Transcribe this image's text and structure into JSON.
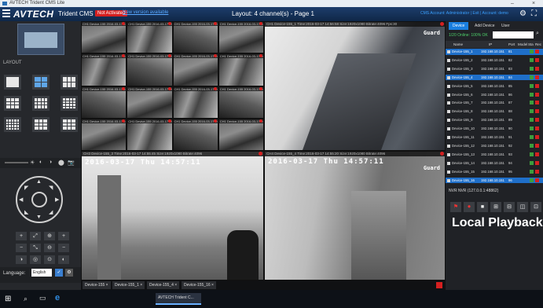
{
  "window": {
    "title": "AVTECH Trident CMS Lite",
    "minimize": "–",
    "close": "×"
  },
  "header": {
    "logo": "AVTECH",
    "app_name": "Trident CMS Lite",
    "not_activated": "Not Activated",
    "new_version": "New version available",
    "layout_title": "Layout: 4 channel(s) - Page 1",
    "account": "CMS Account: Administrator | Exit | Account: demo",
    "gear_icon": "⚙",
    "fullscreen_icon": "⛶"
  },
  "left": {
    "layout_label": "LAYOUT",
    "layouts": [
      {
        "rows": 1,
        "cols": 1,
        "active": false
      },
      {
        "rows": 2,
        "cols": 2,
        "active": true
      },
      {
        "rows": 2,
        "cols": 3,
        "active": false
      },
      {
        "rows": 3,
        "cols": 3,
        "active": false
      },
      {
        "rows": 3,
        "cols": 4,
        "active": false
      },
      {
        "rows": 4,
        "cols": 4,
        "active": false
      },
      {
        "rows": 4,
        "cols": 5,
        "active": false
      },
      {
        "rows": 3,
        "cols": 3,
        "active": false
      },
      {
        "rows": 3,
        "cols": 3,
        "active": false
      }
    ],
    "ptz_icons": [
      "☀",
      "◐",
      "◑",
      "⬤",
      "📷"
    ],
    "arrows": [
      "▲",
      "▼",
      "◀",
      "▶",
      "◤",
      "◥",
      "◣",
      "◢"
    ],
    "ptz_buttons": [
      "+",
      "⤢",
      "⊕",
      "+",
      "−",
      "⤡",
      "⊖",
      "−",
      "◑",
      "◎",
      "⊙",
      "◐"
    ],
    "language_label": "Language:",
    "language_value": "English"
  },
  "videos": {
    "small_header": "CH1 Device-155 2016-03-17 14:56:17",
    "big": [
      {
        "header": "CH1 Device-155_1 Time:2016-03-17 14:56:58 Size:1920x1080 Bitrate:4096 Fps:30",
        "osd": "",
        "guard": "Guard"
      },
      {
        "header": "CH2 Device-155_2 Time:2016-03-17 14:57:32 Size:1920x1080 Bitrate:4096 Fps:30",
        "osd": "",
        "guard": "Guard"
      },
      {
        "header": "CH3 Device-155_3 Time:2016-03-17 14:55:45 Size:1920x1080 Bitrate:4096",
        "osd": "2016-03-17 Thu 14:57:11",
        "guard": ""
      },
      {
        "header": "CH4 Device-155_4 Time:2016-03-17 14:55:20 Size:1920x1080 Bitrate:4096",
        "osd": "2016-03-17 Thu 14:57:11",
        "guard": "Guard"
      }
    ],
    "tabs": [
      "Device-155 ×",
      "Device-155_1 ×",
      "Device-155_4 ×",
      "Device-155_16 ×"
    ]
  },
  "right": {
    "tabs": [
      "Device",
      "Add Device",
      "User"
    ],
    "device_status": "1/20 Online: 100% OK",
    "columns": [
      "Name",
      "IP",
      "Port",
      "Model",
      "Sta",
      "Rec"
    ],
    "devices": [
      {
        "name": "Device-155_1",
        "ip": "192.168.10.151",
        "port": "81",
        "selected": true
      },
      {
        "name": "Device-155_2",
        "ip": "192.168.10.151",
        "port": "82",
        "selected": false
      },
      {
        "name": "Device-155_3",
        "ip": "192.168.10.151",
        "port": "83",
        "selected": false
      },
      {
        "name": "Device-155_4",
        "ip": "192.168.10.151",
        "port": "84",
        "selected": true
      },
      {
        "name": "Device-155_5",
        "ip": "192.168.10.151",
        "port": "85",
        "selected": false
      },
      {
        "name": "Device-155_6",
        "ip": "192.168.10.151",
        "port": "86",
        "selected": false
      },
      {
        "name": "Device-155_7",
        "ip": "192.168.10.151",
        "port": "87",
        "selected": false
      },
      {
        "name": "Device-155_8",
        "ip": "192.168.10.151",
        "port": "88",
        "selected": false
      },
      {
        "name": "Device-155_9",
        "ip": "192.168.10.151",
        "port": "89",
        "selected": false
      },
      {
        "name": "Device-155_10",
        "ip": "192.168.10.151",
        "port": "90",
        "selected": false
      },
      {
        "name": "Device-155_11",
        "ip": "192.168.10.151",
        "port": "91",
        "selected": false
      },
      {
        "name": "Device-155_12",
        "ip": "192.168.10.151",
        "port": "92",
        "selected": false
      },
      {
        "name": "Device-155_13",
        "ip": "192.168.10.151",
        "port": "93",
        "selected": false
      },
      {
        "name": "Device-155_14",
        "ip": "192.168.10.151",
        "port": "94",
        "selected": false
      },
      {
        "name": "Device-155_15",
        "ip": "192.168.10.151",
        "port": "95",
        "selected": false
      },
      {
        "name": "Device-155_16",
        "ip": "192.168.10.151",
        "port": "96",
        "selected": true
      }
    ],
    "nvr": "NVR  NVR  (127.0.0.1:48862)",
    "toolbar_icons": [
      "⚑",
      "⏺",
      "■",
      "⊞",
      "⊟",
      "◫",
      "⊡"
    ],
    "local_playback": "Local Playback"
  },
  "taskbar": {
    "start": "⊞",
    "search": "⌕",
    "taskview": "▭",
    "edge": "e",
    "app": "AVTECH Trident C..."
  }
}
